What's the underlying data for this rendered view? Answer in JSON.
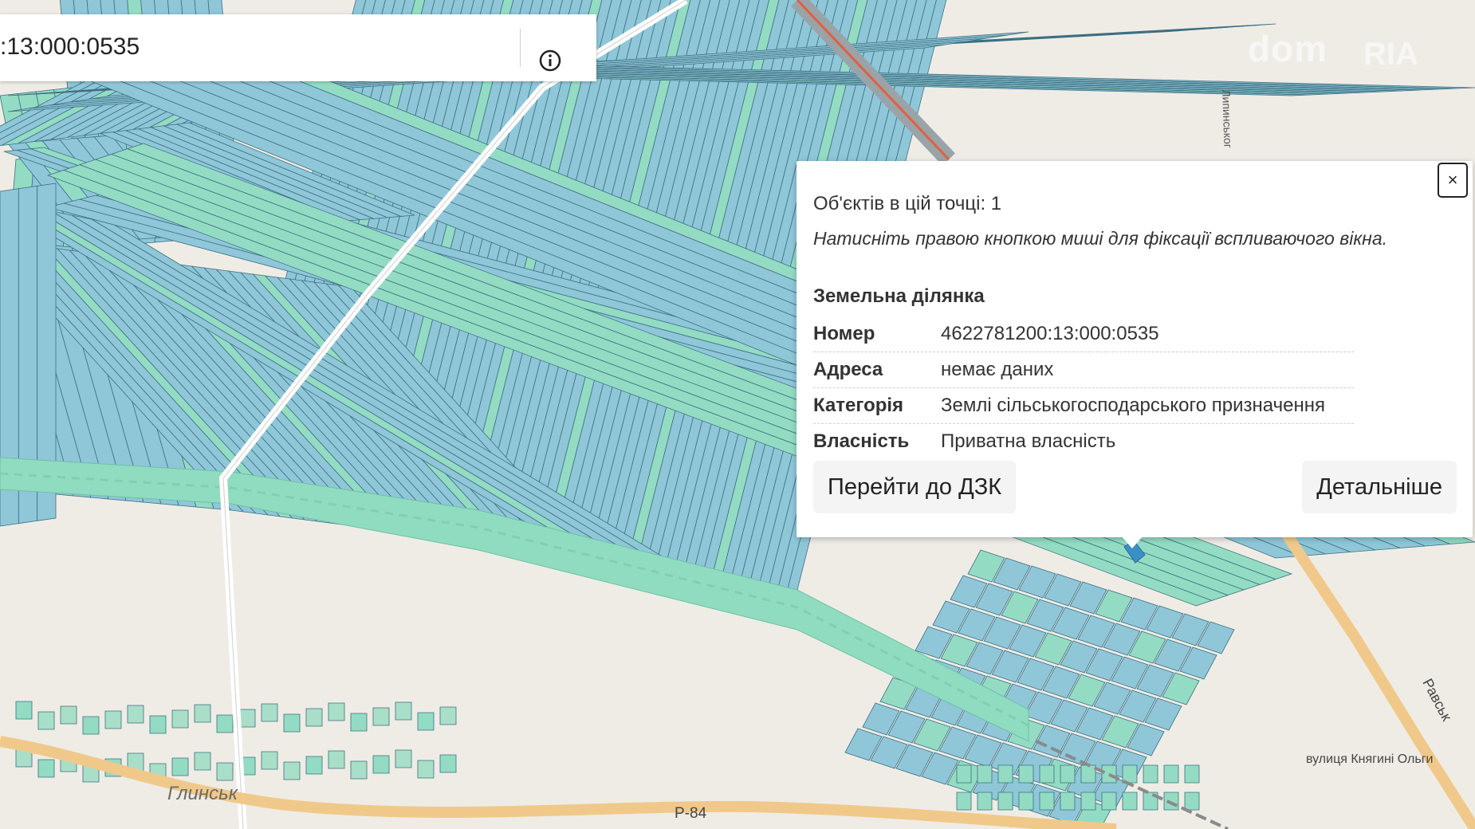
{
  "search": {
    "value": ":13:000:0535",
    "info_icon": "info-icon"
  },
  "watermark": {
    "brand": "dom",
    "brand_suffix": "RIA"
  },
  "map_labels": {
    "village": "Глинськ",
    "road_p84": "Р-84",
    "street_olhy": "вулиця Княгині Ольги",
    "street_ravska": "Равськ",
    "street_lypynska": "Липинськог"
  },
  "popup": {
    "objects_count": "Об'єктів в цій точці: 1",
    "hint": "Натисніть правою кнопкою миші для фіксації вспливаючого вікна.",
    "section_title": "Земельна ділянка",
    "close_label": "×",
    "attributes": [
      {
        "key": "Номер",
        "value": "4622781200:13:000:0535"
      },
      {
        "key": "Адреса",
        "value": "немає даних"
      },
      {
        "key": "Категорія",
        "value": "Землі сільськогосподарського призначення"
      },
      {
        "key": "Власність",
        "value": "Приватна власність"
      }
    ],
    "buttons": {
      "dzk": "Перейти до ДЗК",
      "details": "Детальніше"
    }
  },
  "colors": {
    "background": "#efece6",
    "parcel_blue": "#8fc7d9",
    "parcel_green": "#93dcc3",
    "road_orange": "#f0c98a",
    "road_white": "#ffffff",
    "green_strip": "#8fdcc0"
  }
}
